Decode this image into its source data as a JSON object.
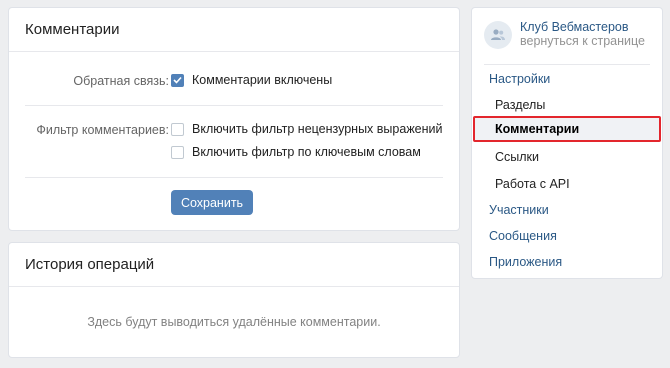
{
  "settings_card": {
    "title": "Комментарии",
    "feedback_label": "Обратная связь:",
    "comments_enabled_label": "Комментарии включены",
    "comments_enabled_checked": true,
    "filter_label": "Фильтр комментариев:",
    "filter_obscene_label": "Включить фильтр нецензурных выражений",
    "filter_obscene_checked": false,
    "filter_keywords_label": "Включить фильтр по ключевым словам",
    "filter_keywords_checked": false,
    "save_label": "Сохранить"
  },
  "history_card": {
    "title": "История операций",
    "empty_text": "Здесь будут выводиться удалённые комментарии."
  },
  "sidebar": {
    "club_name": "Клуб Вебмастеров",
    "back_link": "вернуться к странице",
    "items": [
      {
        "label": "Настройки",
        "level": "top"
      },
      {
        "label": "Разделы",
        "level": "sub"
      },
      {
        "label": "Комментарии",
        "level": "sub",
        "active": true
      },
      {
        "label": "Ссылки",
        "level": "sub"
      },
      {
        "label": "Работа с API",
        "level": "sub"
      },
      {
        "label": "Участники",
        "level": "top"
      },
      {
        "label": "Сообщения",
        "level": "top"
      },
      {
        "label": "Приложения",
        "level": "top"
      }
    ]
  },
  "colors": {
    "accent": "#5181b8",
    "link": "#2a5885",
    "highlight_border": "#e3262d",
    "background": "#edeef0"
  }
}
